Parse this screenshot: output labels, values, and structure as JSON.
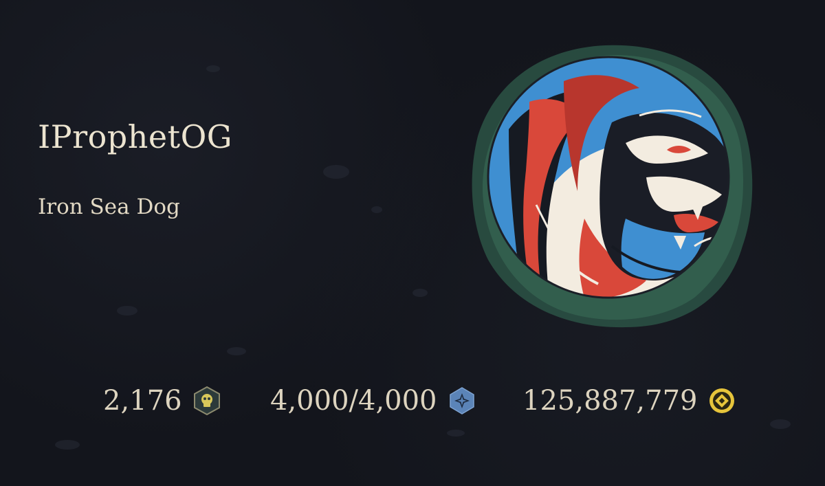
{
  "profile": {
    "gamertag": "IProphetOG",
    "title": "Iron Sea Dog",
    "emblem_icon": "roaring-lion-emblem"
  },
  "stats": [
    {
      "value": "2,176",
      "icon": "skull-hexagon-icon"
    },
    {
      "value": "4,000/4,000",
      "icon": "star-hexagon-icon"
    },
    {
      "value": "125,887,779",
      "icon": "gold-coin-icon"
    }
  ],
  "colors": {
    "background": "#13151c",
    "text": "#e9e1cf",
    "emblem_ring": "#2e5a4a",
    "doubloon_hex": "#2c3a3a",
    "ancient_coin_hex": "#5b84b8",
    "gold": "#e6c43b"
  }
}
